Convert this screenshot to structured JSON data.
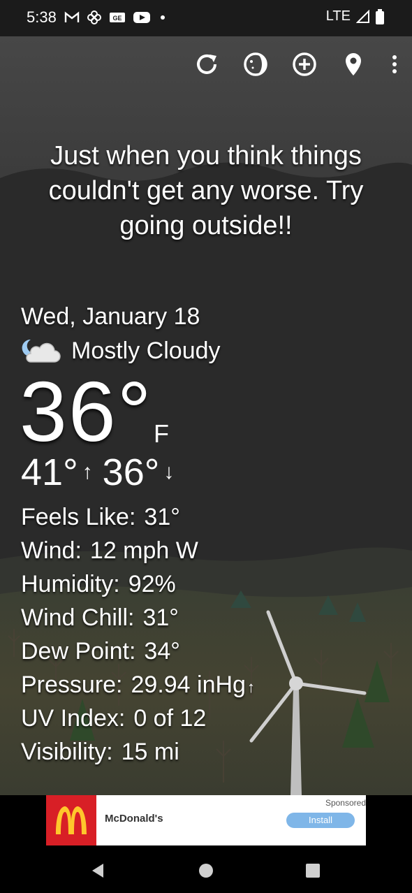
{
  "status": {
    "time": "5:38",
    "network": "LTE",
    "icons": [
      "gmail-icon",
      "pinwheel-icon",
      "news-icon",
      "youtube-icon",
      "dot-icon"
    ]
  },
  "toolbar": {
    "icons": [
      "refresh-icon",
      "moon-phase-icon",
      "add-location-icon",
      "location-pin-icon",
      "more-vert-icon"
    ]
  },
  "headline": "Just when you think things couldn't get any worse. Try going outside!!",
  "weather": {
    "date": "Wed, January 18",
    "condition": "Mostly Cloudy",
    "temp": "36°",
    "unit": "F",
    "high": "41°",
    "low": "36°",
    "high_arrow": "↑",
    "low_arrow": "↓",
    "details": [
      {
        "label": "Feels Like:",
        "value": "31°"
      },
      {
        "label": "Wind:",
        "value": "12 mph W"
      },
      {
        "label": "Humidity:",
        "value": "92%"
      },
      {
        "label": "Wind Chill:",
        "value": "31°"
      },
      {
        "label": "Dew Point:",
        "value": "34°"
      },
      {
        "label": "Pressure:",
        "value": "29.94 inHg",
        "trend": "↑"
      },
      {
        "label": "UV Index:",
        "value": "0 of 12"
      },
      {
        "label": "Visibility:",
        "value": "15 mi"
      }
    ]
  },
  "ad": {
    "advertiser": "McDonald's",
    "sponsored": "Sponsored",
    "install_label": "Install",
    "brand_color": "#d81f26",
    "logo_color": "#ffc72c"
  },
  "navbar": {
    "icons": [
      "back-icon",
      "home-icon",
      "recents-icon"
    ]
  }
}
